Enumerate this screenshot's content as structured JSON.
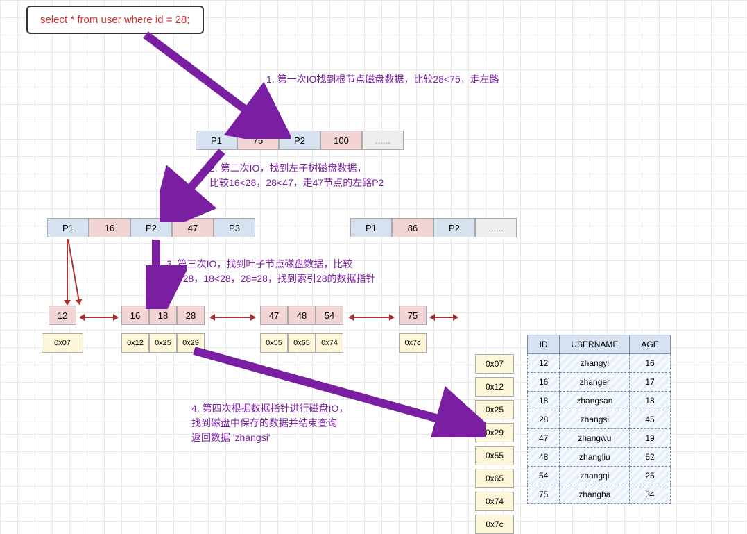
{
  "sql": "select * from user where id = 28;",
  "annotations": {
    "s1": "1. 第一次IO找到根节点磁盘数据，比较28<75，走左路",
    "s2a": "2. 第二次IO，找到左子树磁盘数据，",
    "s2b": "比较16<28，28<47，走47节点的左路P2",
    "s3a": "3. 第三次IO，找到叶子节点磁盘数据，比较",
    "s3b": "16<28，18<28，28=28，找到索引28的数据指针",
    "s4a": "4. 第四次根据数据指针进行磁盘IO，",
    "s4b": "找到磁盘中保存的数据并结束查询",
    "s4c": "返回数据 'zhangsi'"
  },
  "root": [
    "P1",
    "75",
    "P2",
    "100",
    "......"
  ],
  "level2_left": [
    "P1",
    "16",
    "P2",
    "47",
    "P3"
  ],
  "level2_right": [
    "P1",
    "86",
    "P2",
    "......"
  ],
  "leaf1": {
    "keys": [
      "12"
    ],
    "addrs": [
      "0x07"
    ]
  },
  "leaf2": {
    "keys": [
      "16",
      "18",
      "28"
    ],
    "addrs": [
      "0x12",
      "0x25",
      "0x29"
    ]
  },
  "leaf3": {
    "keys": [
      "47",
      "48",
      "54"
    ],
    "addrs": [
      "0x55",
      "0x65",
      "0x74"
    ]
  },
  "leaf4": {
    "keys": [
      "75"
    ],
    "addrs": [
      "0x7c"
    ]
  },
  "disk_addrs": [
    "0x07",
    "0x12",
    "0x25",
    "0x29",
    "0x55",
    "0x65",
    "0x74",
    "0x7c"
  ],
  "table": {
    "headers": [
      "ID",
      "USERNAME",
      "AGE"
    ],
    "rows": [
      [
        "12",
        "zhangyi",
        "16"
      ],
      [
        "16",
        "zhanger",
        "17"
      ],
      [
        "18",
        "zhangsan",
        "18"
      ],
      [
        "28",
        "zhangsi",
        "45"
      ],
      [
        "47",
        "zhangwu",
        "19"
      ],
      [
        "48",
        "zhangliu",
        "52"
      ],
      [
        "54",
        "zhangqi",
        "25"
      ],
      [
        "75",
        "zhangba",
        "34"
      ]
    ]
  }
}
